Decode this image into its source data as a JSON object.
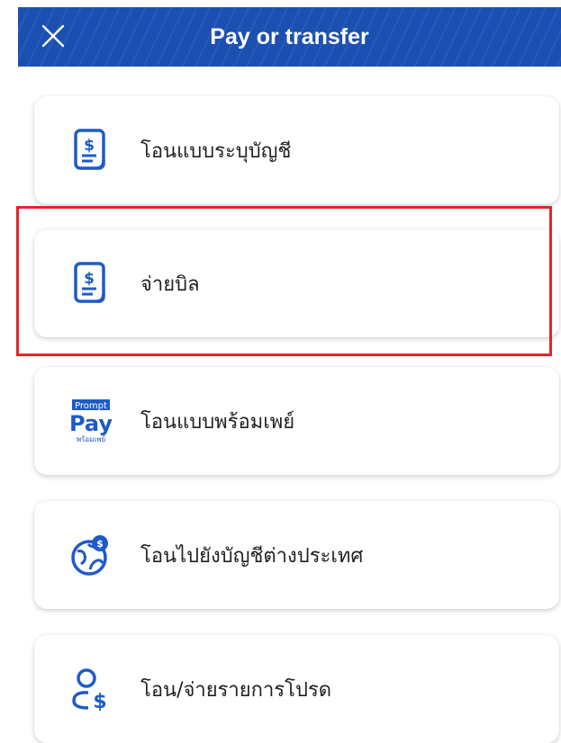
{
  "header": {
    "title": "Pay or transfer",
    "close_icon": "close-icon",
    "background_color": "#1b4fb0"
  },
  "menu": {
    "items": [
      {
        "label": "โอนแบบระบุบัญชี",
        "icon": "bill-document-icon"
      },
      {
        "label": "จ่ายบิล",
        "icon": "bill-document-icon",
        "highlighted": true
      },
      {
        "label": "โอนแบบพร้อมเพย์",
        "icon": "promptpay-logo-icon",
        "logo_text_top": "Prompt",
        "logo_text_main": "Pay",
        "logo_text_sub": "พร้อมเพย์"
      },
      {
        "label": "โอนไปยังบัญชีต่างประเทศ",
        "icon": "globe-dollar-icon"
      },
      {
        "label": "โอน/จ่ายรายการโปรด",
        "icon": "favorite-payee-icon"
      }
    ]
  },
  "colors": {
    "accent": "#1b4fb0",
    "icon_blue": "#1e5bc6",
    "highlight_border": "#e3262a"
  }
}
